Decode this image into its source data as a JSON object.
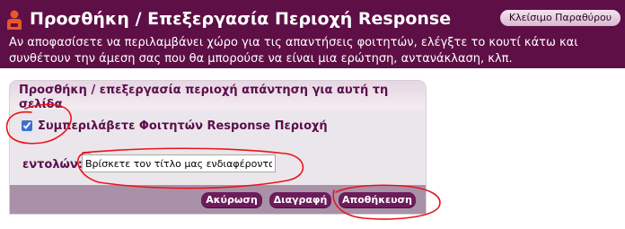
{
  "header": {
    "title": "Προσθήκη / Επεξεργασία Περιοχή Response",
    "description": "Αν αποφασίσετε να περιλαμβάνει χώρο για τις απαντήσεις φοιτητών, ελέγξτε το κουτί κάτω και συνθέτουν την άμεση σας που θα μπορούσε να είναι μια ερώτηση, αντανάκλαση, κλπ.",
    "close_label": "Κλείσιμο Παραθύρου",
    "icon": "person-icon"
  },
  "panel": {
    "title": "Προσθήκη / επεξεργασία περιοχή απάντηση για αυτή τη σελίδα",
    "checkbox_label": "Συμπεριλάβετε Φοιτητών Response Περιοχή",
    "checkbox_checked": true,
    "field_label": "εντολών:",
    "field_value": "Βρίσκετε τον τίτλο μας ενδιαφέροντα:",
    "buttons": {
      "cancel": "Ακύρωση",
      "delete": "Διαγραφή",
      "save": "Αποθήκευση"
    }
  },
  "colors": {
    "header_bg": "#5e0f45",
    "accent_text": "#5b0e4c",
    "button_bg": "#6d1c5b",
    "footer_bg": "#a992a8",
    "annotation": "#e8141b"
  }
}
